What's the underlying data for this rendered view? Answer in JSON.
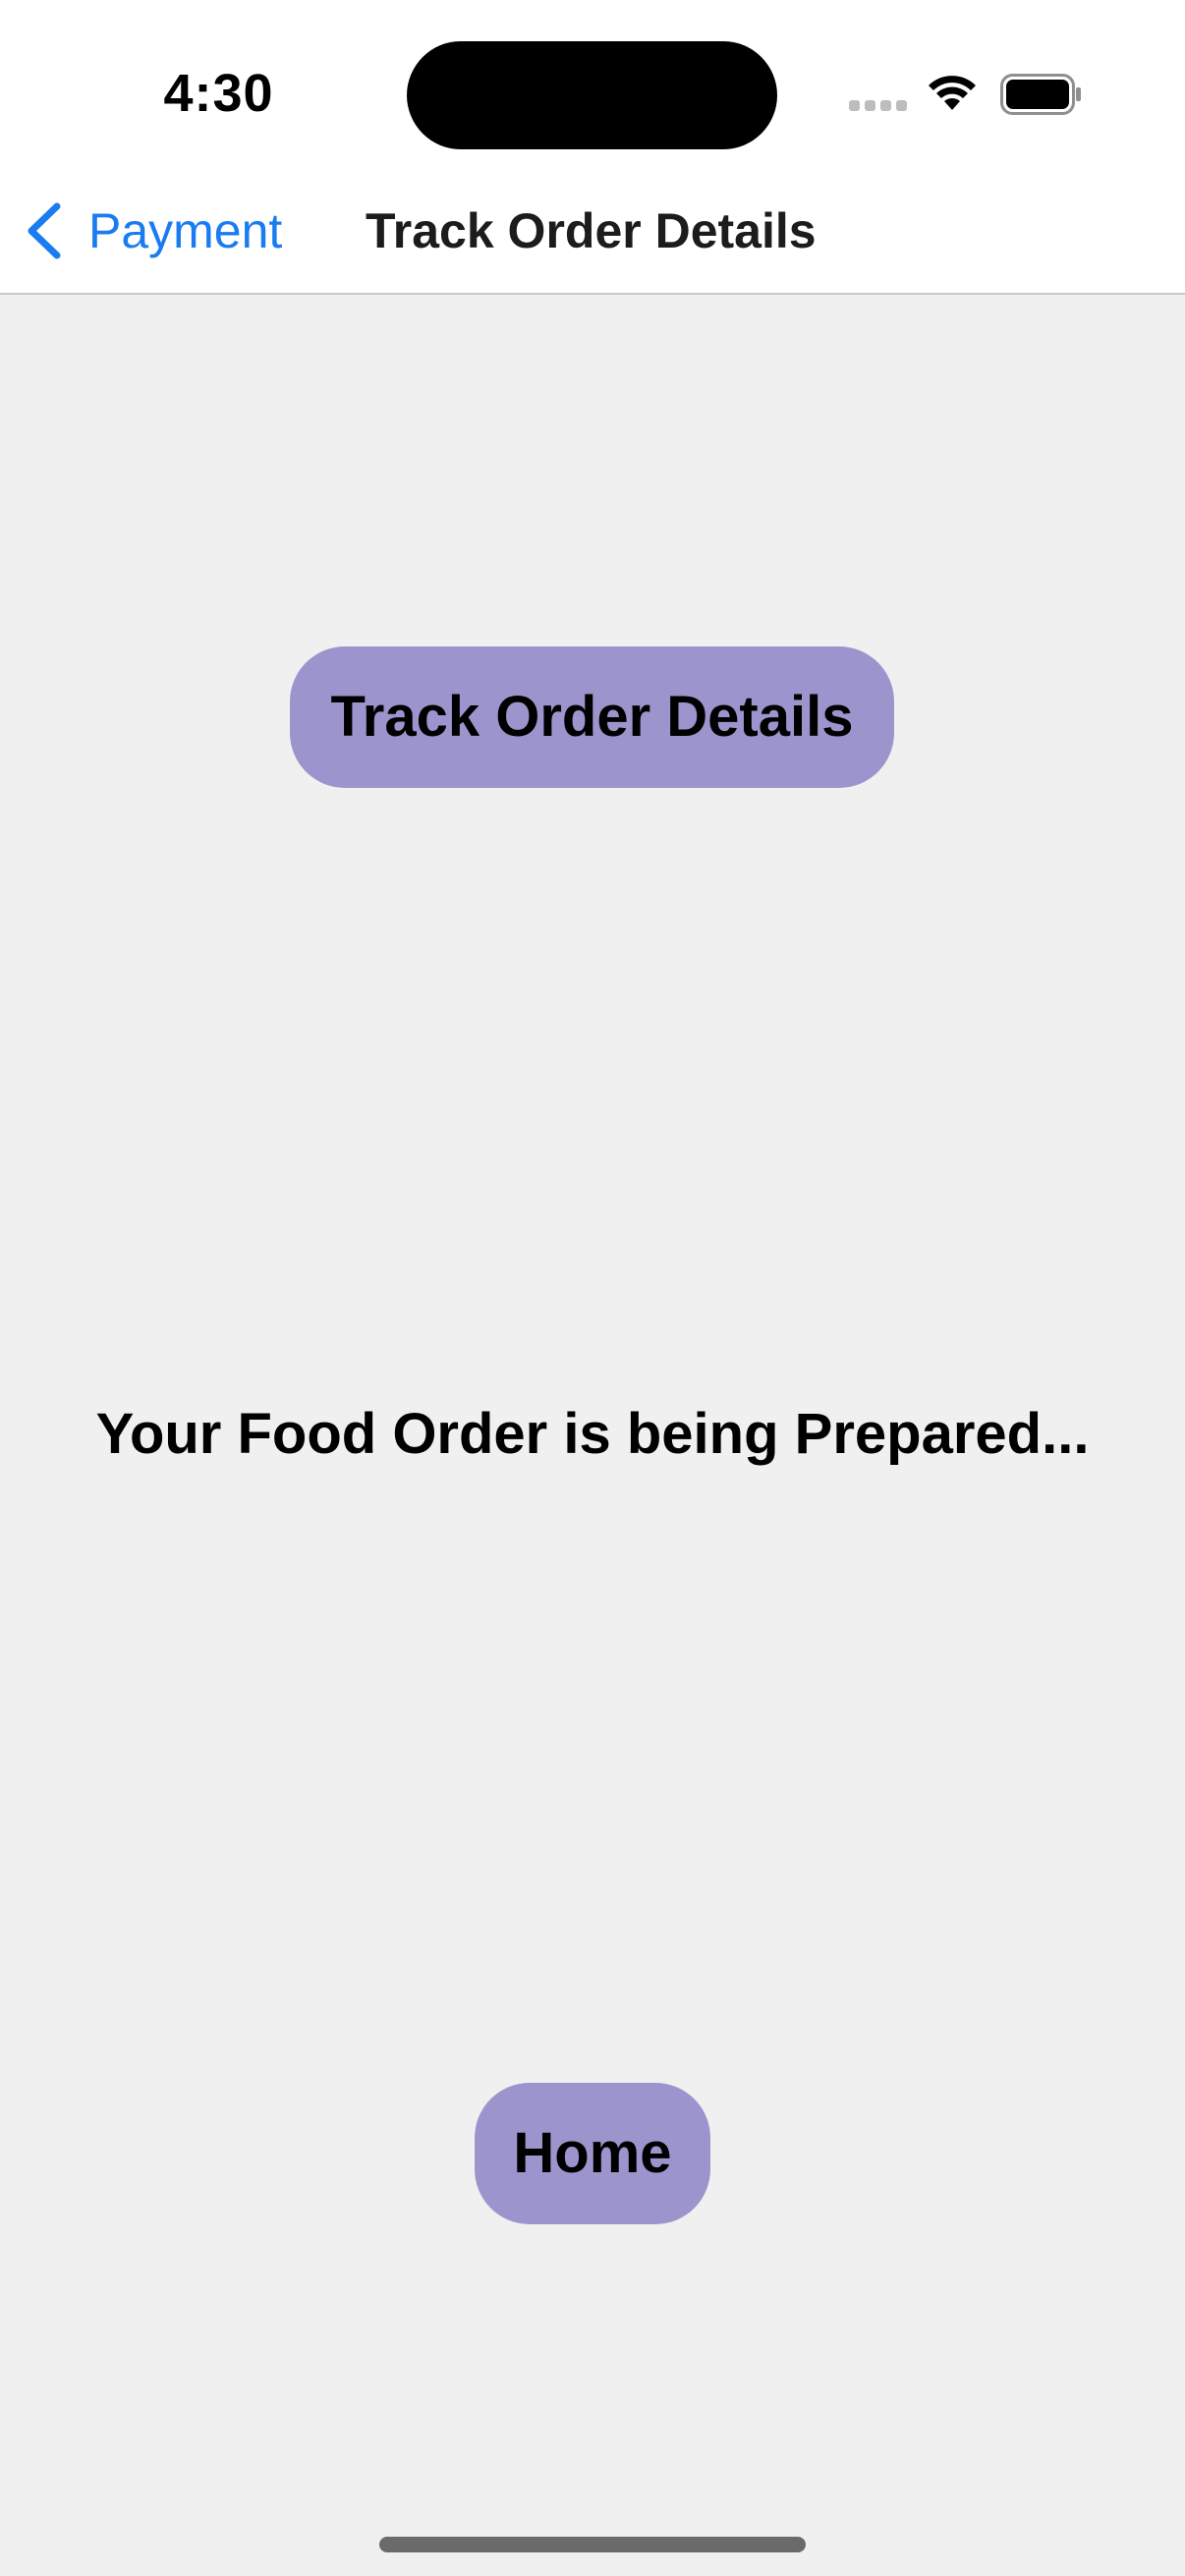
{
  "status_bar": {
    "time": "4:30",
    "icons": [
      "cellular-signal-icon",
      "wifi-icon",
      "battery-icon"
    ]
  },
  "nav": {
    "back_label": "Payment",
    "back_icon": "chevron-left-icon",
    "title": "Track Order Details"
  },
  "main": {
    "track_button_label": "Track Order Details",
    "status_message": "Your Food Order is being Prepared...",
    "home_button_label": "Home"
  },
  "colors": {
    "accent": "#1a7cf1",
    "pill_background": "#9c95cd",
    "page_background": "#f0f0f0"
  }
}
